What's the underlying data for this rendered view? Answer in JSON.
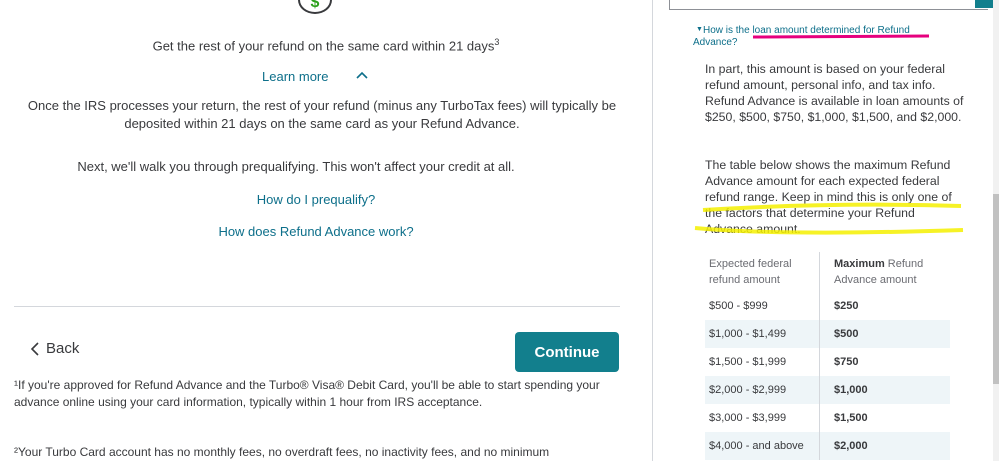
{
  "left": {
    "dollar_symbol": "$",
    "same_card_text": "Get the rest of your refund on the same card within 21 days",
    "same_card_sup": "3",
    "learn_more": "Learn more",
    "paragraph": "Once the IRS processes your return, the rest of your refund (minus any TurboTax fees) will typically be deposited within 21 days on the same card as your Refund Advance.",
    "next_text": "Next, we'll walk you through prequalifying. This won't affect your credit at all.",
    "prequalify_link": "How do I prequalify?",
    "how_works_link": "How does Refund Advance work?",
    "back_label": "Back",
    "continue_label": "Continue",
    "footnote1": "¹If you're approved for Refund Advance and the Turbo® Visa® Debit Card, you'll be able to start spending your advance online using your card information, typically within 1 hour from IRS acceptance.",
    "footnote2": "²Your Turbo Card account has no monthly fees, no overdraft fees, no inactivity fees, and no minimum"
  },
  "right": {
    "question": "How is the loan amount determined for Refund Advance?",
    "answer1": "In part, this amount is based on your federal refund amount, personal info, and tax info. Refund Advance is available in loan amounts of $250, $500, $750, $1,000, $1,500, and $2,000.",
    "answer2": "The table below shows the maximum Refund Advance amount for each expected federal refund range. Keep in mind this is only one of the factors that determine your Refund Advance amount.",
    "table": {
      "header_col1": "Expected federal refund amount",
      "header_col2_bold": "Maximum",
      "header_col2_rest": " Refund Advance amount",
      "rows": [
        {
          "range": "$500 - $999",
          "max": "$250"
        },
        {
          "range": "$1,000 - $1,499",
          "max": "$500"
        },
        {
          "range": "$1,500 - $1,999",
          "max": "$750"
        },
        {
          "range": "$2,000 - $2,999",
          "max": "$1,000"
        },
        {
          "range": "$3,000 - $3,999",
          "max": "$1,500"
        },
        {
          "range": "$4,000 - and above",
          "max": "$2,000"
        }
      ]
    },
    "annotation_colors": {
      "magenta": "#e6007e",
      "yellow": "#f5f000"
    }
  },
  "colors": {
    "brand_teal": "#127f8d",
    "link": "#0d6f8a",
    "money_green": "#2ca01c"
  }
}
